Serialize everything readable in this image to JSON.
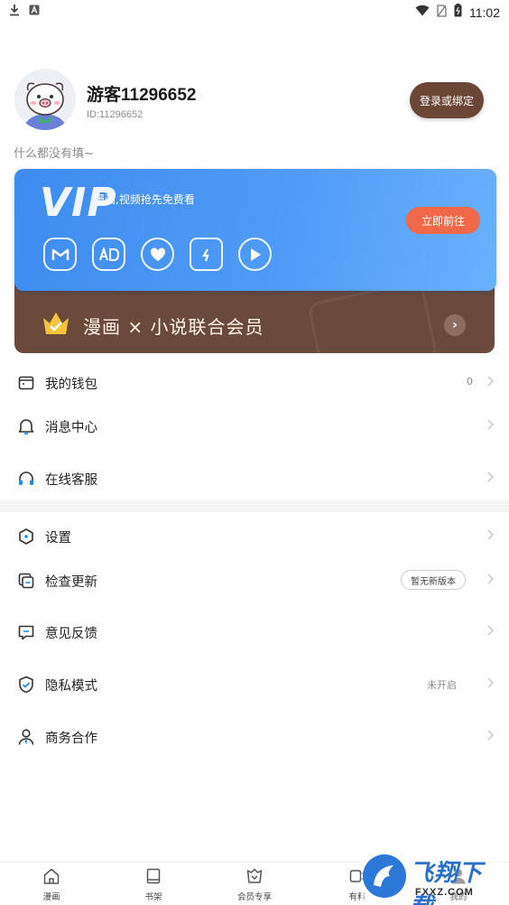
{
  "status_bar": {
    "time": "11:02"
  },
  "profile": {
    "username": "游客11296652",
    "user_id": "ID:11296652",
    "login_button": "登录或绑定",
    "bio": "什么都没有填~"
  },
  "vip_card": {
    "title": "VIP",
    "subtitle": "漫画,视频抢先免费看",
    "cta": "立即前往",
    "perk_icons": [
      "manga-icon",
      "ad-free-icon",
      "heart-icon",
      "crown-lightning-icon",
      "play-icon"
    ]
  },
  "member_card": {
    "text": "漫画 × 小说联合会员"
  },
  "menu_group_1": [
    {
      "label": "我的钱包",
      "value": "0",
      "icon": "wallet-icon"
    },
    {
      "label": "消息中心",
      "icon": "bell-icon"
    },
    {
      "label": "在线客服",
      "icon": "headset-icon"
    }
  ],
  "menu_group_2": [
    {
      "label": "设置",
      "icon": "settings-icon"
    },
    {
      "label": "检查更新",
      "badge": "暂无新版本",
      "icon": "update-icon"
    },
    {
      "label": "意见反馈",
      "icon": "feedback-icon"
    },
    {
      "label": "隐私模式",
      "value": "未开启",
      "icon": "shield-check-icon"
    },
    {
      "label": "商务合作",
      "icon": "business-person-icon"
    }
  ],
  "tab_bar": [
    {
      "label": "漫画",
      "icon": "home-icon"
    },
    {
      "label": "书架",
      "icon": "book-icon"
    },
    {
      "label": "会员专享",
      "icon": "vip-bag-icon"
    },
    {
      "label": "有料",
      "icon": "video-icon"
    },
    {
      "label": "我的",
      "icon": "user-icon",
      "active": true
    }
  ],
  "watermark": {
    "brand": "飞翔下载",
    "url": "FXXZ.COM"
  }
}
